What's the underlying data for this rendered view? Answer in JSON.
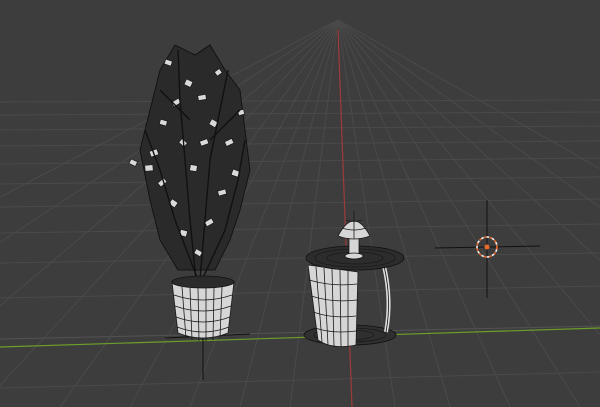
{
  "viewport": {
    "background": "#3d3d3d",
    "grid_color": "#4a4a4a",
    "x_axis_color": "#6e9e2a",
    "y_axis_color": "#9e3b3b"
  },
  "scene": {
    "objects": [
      {
        "name": "potted-plant",
        "icon": "plant-mesh"
      },
      {
        "name": "side-table-with-lamp",
        "icon": "table-mesh"
      },
      {
        "name": "3d-cursor",
        "icon": "crosshair-icon",
        "color": "#e86b2a"
      }
    ]
  }
}
